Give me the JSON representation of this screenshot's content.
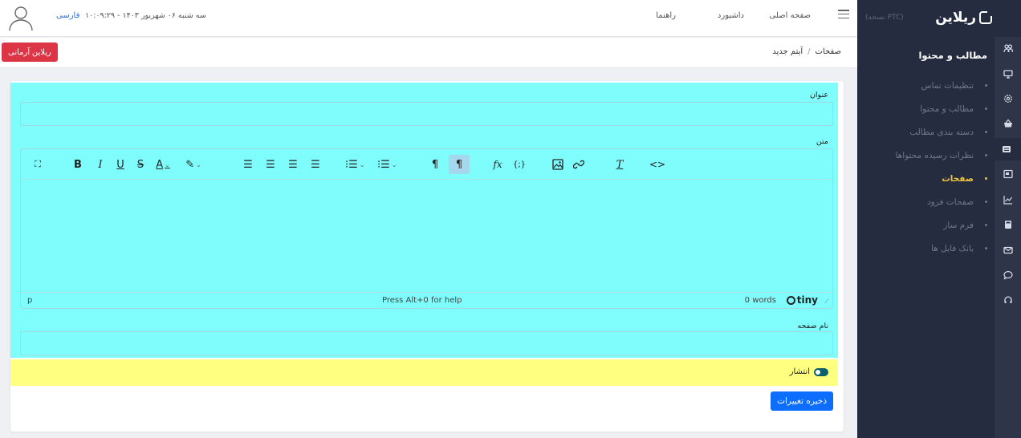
{
  "sidebar": {
    "brand": "ریلاین",
    "version": "(نسخه PTC)",
    "section_title": "مطالب و محتوا",
    "items": [
      {
        "label": "تنظیمات تماس",
        "active": false
      },
      {
        "label": "مطالب و محتوا",
        "active": false
      },
      {
        "label": "دسته بندی مطالب",
        "active": false
      },
      {
        "label": "نظرات رسیده محتواها",
        "active": false
      },
      {
        "label": "صفحات",
        "active": true
      },
      {
        "label": "صفحات فرود",
        "active": false
      },
      {
        "label": "فرم ساز",
        "active": false
      },
      {
        "label": "بانک فایل ها",
        "active": false
      }
    ],
    "rail_icons": [
      "users-icon",
      "monitor-icon",
      "settings-icon",
      "basket-icon",
      "content-icon",
      "pages-icon",
      "chart-icon",
      "calculator-icon",
      "mail-icon",
      "chat-icon",
      "headset-icon"
    ],
    "accent_color": "#f2c53d"
  },
  "topbar": {
    "nav": [
      "صفحه اصلی",
      "داشبورد",
      "راهنما"
    ],
    "datetime": "سه شنبه ۰۶ شهریور ۱۴۰۳ - ۱۰:۰۹:۲۹",
    "language": "فارسی"
  },
  "breadcrumb": {
    "parent": "صفحات",
    "current": "آیتم جدید"
  },
  "header_button": "ریلاین آرمانی",
  "form": {
    "title_label": "عنوان",
    "title_value": "",
    "body_label": "متن",
    "page_name_label": "نام صفحه",
    "page_name_value": "",
    "publish_label": "انتشار",
    "publish_on": true,
    "save_label": "ذخیره تغییرات"
  },
  "editor": {
    "status_path": "p",
    "help_text": "Press Alt+0 for help",
    "word_count": "0 words",
    "brand": "tiny"
  },
  "colors": {
    "highlight_cyan": "#7ffcfc",
    "highlight_yellow": "#ffff80",
    "danger": "#dc3545",
    "primary": "#0d6efd"
  }
}
